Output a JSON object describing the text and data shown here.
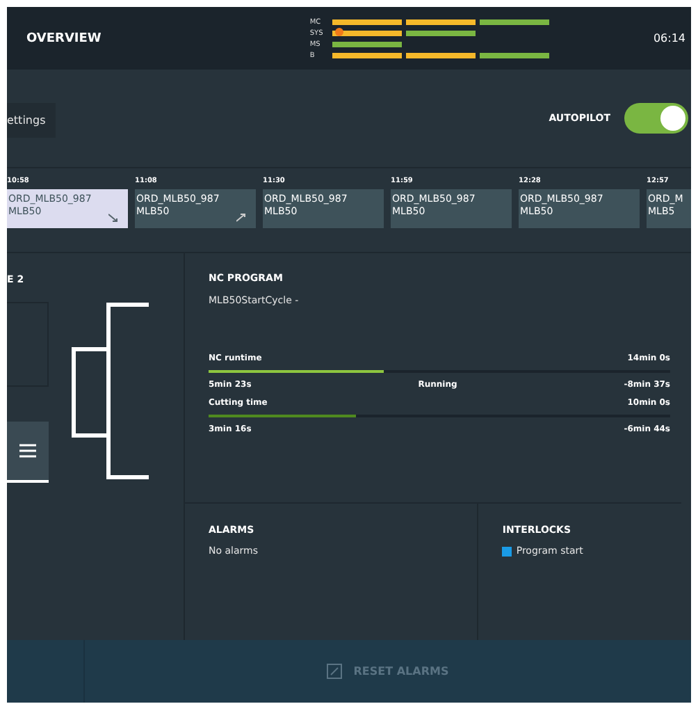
{
  "header": {
    "title": "OVERVIEW",
    "time": "06:14",
    "status": [
      {
        "label": "MC",
        "segments": [
          {
            "color": "#f5b82a",
            "warning": false
          },
          {
            "color": "#f5b82a",
            "warning": false
          },
          {
            "color": "#7ab642",
            "warning": false
          }
        ]
      },
      {
        "label": "SYS",
        "segments": [
          {
            "color": "#f5b82a",
            "warning": true
          },
          {
            "color": "#7ab642",
            "warning": false
          }
        ]
      },
      {
        "label": "MS",
        "segments": [
          {
            "color": "#7ab642",
            "warning": false
          }
        ]
      },
      {
        "label": "B",
        "segments": [
          {
            "color": "#f5b82a",
            "warning": false
          },
          {
            "color": "#f5b82a",
            "warning": false
          },
          {
            "color": "#7ab642",
            "warning": false
          }
        ]
      }
    ]
  },
  "toolbar": {
    "settings_button": "ettings",
    "autopilot": {
      "label": "AUTOPILOT",
      "on": true
    }
  },
  "timeline": [
    {
      "time": "10:58",
      "order": "ORD_MLB50_987",
      "machine": "MLB50",
      "selected": true,
      "kind": "falling"
    },
    {
      "time": "11:08",
      "order": "ORD_MLB50_987",
      "machine": "MLB50",
      "selected": false,
      "kind": "rising"
    },
    {
      "time": "11:30",
      "order": "ORD_MLB50_987",
      "machine": "MLB50",
      "selected": false,
      "kind": "plain"
    },
    {
      "time": "11:59",
      "order": "ORD_MLB50_987",
      "machine": "MLB50",
      "selected": false,
      "kind": "plain"
    },
    {
      "time": "12:28",
      "order": "ORD_MLB50_987",
      "machine": "MLB50",
      "selected": false,
      "kind": "plain"
    },
    {
      "time": "12:57",
      "order": "ORD_M",
      "machine": "MLB5",
      "selected": false,
      "kind": "plain"
    }
  ],
  "left_panel": {
    "title": "E 2"
  },
  "nc_program": {
    "title": "NC PROGRAM",
    "program": "MLB50StartCycle -",
    "meters": [
      {
        "label": "NC runtime",
        "total": "14min 0s",
        "level": 0.38,
        "color": "#8dc63f",
        "elapsed": "5min 23s",
        "status": "Running",
        "remaining": "-8min 37s"
      },
      {
        "label": "Cutting time",
        "total": "10min 0s",
        "level": 0.32,
        "color": "#4f8a1f",
        "elapsed": "3min 16s",
        "remaining": "-6min 44s"
      }
    ]
  },
  "alarms": {
    "title": "ALARMS",
    "message": "No alarms"
  },
  "interlocks": {
    "title": "INTERLOCKS",
    "items": [
      {
        "label": "Program start",
        "color": "#1a9be6"
      }
    ]
  },
  "footer": {
    "reset_button": {
      "label": "RESET ALARMS",
      "disabled": true
    }
  }
}
